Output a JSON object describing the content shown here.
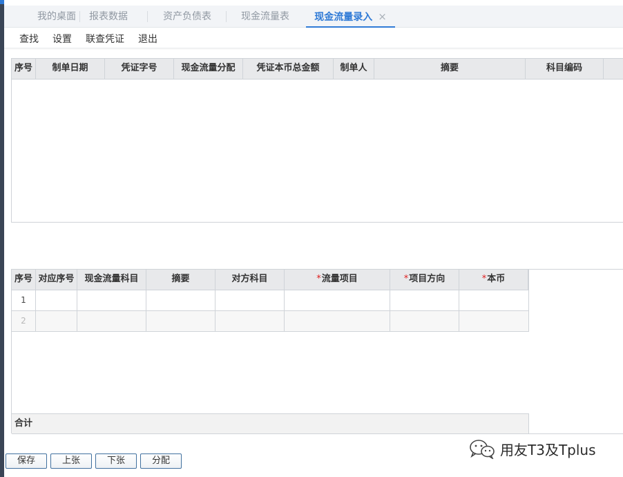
{
  "tabs": [
    {
      "label": "我的桌面",
      "active": false
    },
    {
      "label": "报表数据",
      "active": false
    },
    {
      "label": "资产负债表",
      "active": false
    },
    {
      "label": "现金流量表",
      "active": false
    },
    {
      "label": "现金流量录入",
      "active": true
    }
  ],
  "tab_close_glyph": "×",
  "toolbar": {
    "find": "查找",
    "settings": "设置",
    "linked_voucher": "联查凭证",
    "exit": "退出"
  },
  "voucher_table": {
    "columns": [
      "序号",
      "制单日期",
      "凭证字号",
      "现金流量分配",
      "凭证本币总金额",
      "制单人",
      "摘要",
      "科目编码"
    ],
    "rows": []
  },
  "flow_table": {
    "columns": [
      {
        "label": "序号",
        "required": false
      },
      {
        "label": "对应序号",
        "required": false
      },
      {
        "label": "现金流量科目",
        "required": false
      },
      {
        "label": "摘要",
        "required": false
      },
      {
        "label": "对方科目",
        "required": false
      },
      {
        "label": "流量项目",
        "required": true
      },
      {
        "label": "项目方向",
        "required": true
      },
      {
        "label": "本币",
        "required": true
      }
    ],
    "required_mark": "*",
    "rows": [
      {
        "index": "1",
        "cells": [
          "",
          "",
          "",
          "",
          "",
          "",
          ""
        ]
      },
      {
        "index": "2",
        "cells": [
          "",
          "",
          "",
          "",
          "",
          "",
          ""
        ]
      }
    ],
    "total_label": "合计"
  },
  "buttons": {
    "save": "保存",
    "prev": "上张",
    "next": "下张",
    "allocate": "分配"
  },
  "watermark": {
    "text": "用友T3及Tplus"
  },
  "colors": {
    "accent": "#2f7ad6",
    "required": "#e02020",
    "header_bg": "#e8e9eb",
    "button_border": "#3f6f9e"
  }
}
